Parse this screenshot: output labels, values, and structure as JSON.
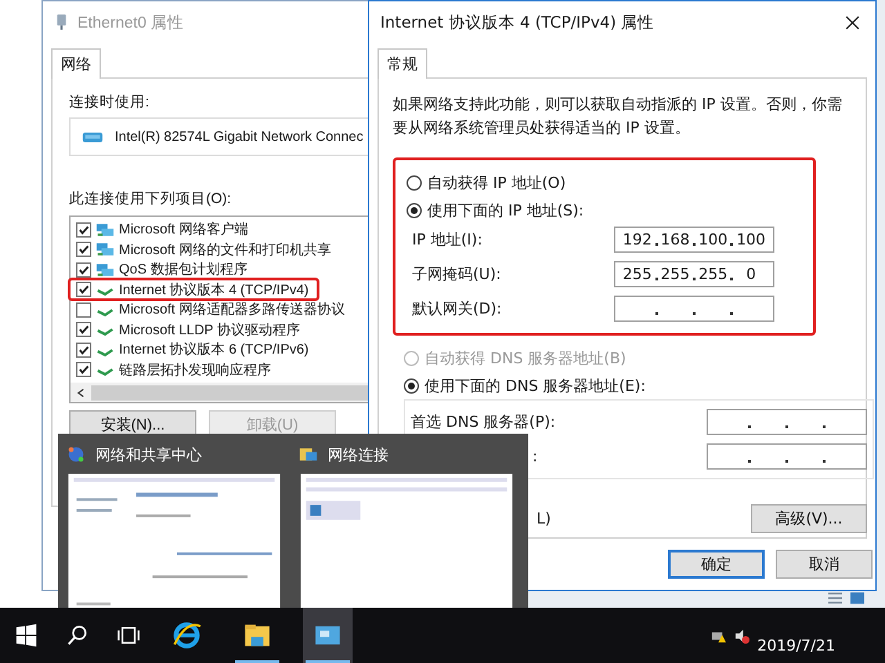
{
  "ethernet_dialog": {
    "title": "Ethernet0 属性",
    "tabs": [
      {
        "label": "网络",
        "selected": true
      }
    ],
    "connect_using_label": "连接时使用:",
    "adapter": "Intel(R) 82574L Gigabit Network Connec",
    "items_label": "此连接使用下列项目(O):",
    "items": [
      {
        "label": "Microsoft 网络客户端",
        "checked": true,
        "highlighted": false,
        "kind": "client"
      },
      {
        "label": "Microsoft 网络的文件和打印机共享",
        "checked": true,
        "highlighted": false,
        "kind": "client"
      },
      {
        "label": "QoS 数据包计划程序",
        "checked": true,
        "highlighted": false,
        "kind": "client"
      },
      {
        "label": "Internet 协议版本 4 (TCP/IPv4)",
        "checked": true,
        "highlighted": true,
        "kind": "protocol"
      },
      {
        "label": "Microsoft 网络适配器多路传送器协议",
        "checked": false,
        "highlighted": false,
        "kind": "protocol"
      },
      {
        "label": "Microsoft LLDP 协议驱动程序",
        "checked": true,
        "highlighted": false,
        "kind": "protocol"
      },
      {
        "label": "Internet 协议版本 6 (TCP/IPv6)",
        "checked": true,
        "highlighted": false,
        "kind": "protocol"
      },
      {
        "label": "链路层拓扑发现响应程序",
        "checked": true,
        "highlighted": false,
        "kind": "protocol"
      }
    ],
    "buttons": [
      {
        "label": "安装(N)...",
        "disabled": false
      },
      {
        "label": "卸载(U)",
        "disabled": true
      }
    ]
  },
  "ipv4_dialog": {
    "title": "Internet 协议版本 4 (TCP/IPv4) 属性",
    "tabs": [
      {
        "label": "常规",
        "selected": true
      }
    ],
    "description": "如果网络支持此功能，则可以获取自动指派的 IP 设置。否则，你需要从网络系统管理员处获得适当的 IP 设置。",
    "ip_section": {
      "highlighted": true,
      "options": [
        {
          "label": "自动获得 IP 地址(O)",
          "selected": false,
          "disabled": false
        },
        {
          "label": "使用下面的 IP 地址(S):",
          "selected": true,
          "disabled": false
        }
      ],
      "fields": [
        {
          "label": "IP 地址(I):",
          "octets": [
            "192",
            "168",
            "100",
            "100"
          ]
        },
        {
          "label": "子网掩码(U):",
          "octets": [
            "255",
            "255",
            "255",
            "0"
          ]
        },
        {
          "label": "默认网关(D):"
        }
      ]
    },
    "dns_section": {
      "options": [
        {
          "label": "自动获得 DNS 服务器地址(B)",
          "selected": false,
          "disabled": true
        },
        {
          "label": "使用下面的 DNS 服务器地址(E):",
          "selected": true,
          "disabled": false
        }
      ],
      "fields": [
        {
          "label": "首选 DNS 服务器(P):"
        },
        {
          "label": ":"
        }
      ]
    },
    "validate_label": "L)",
    "advanced_button": "高级(V)...",
    "footer_buttons": [
      {
        "label": "确定",
        "default": true
      },
      {
        "label": "取消",
        "default": false
      }
    ]
  },
  "taskbar_previews": [
    {
      "title": "网络和共享中心",
      "kind": "sharing"
    },
    {
      "title": "网络连接",
      "kind": "connections"
    }
  ],
  "taskbar": {
    "apps": [
      {
        "kind": "ie",
        "active": false,
        "running": false
      },
      {
        "kind": "explorer",
        "active": false,
        "running": true
      },
      {
        "kind": "network",
        "active": true,
        "running": true
      }
    ],
    "clock": "2019/7/21"
  }
}
